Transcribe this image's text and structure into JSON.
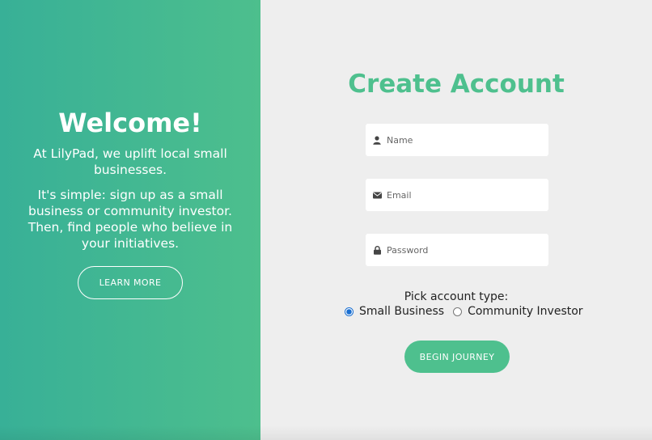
{
  "welcome": {
    "title": "Welcome!",
    "paragraph1": "At LilyPad, we uplift local small businesses.",
    "paragraph2": "It's simple: sign up as a small business or community investor. Then, find people who believe in your initiatives.",
    "learn_more_label": "LEARN MORE"
  },
  "form": {
    "title": "Create Account",
    "name_placeholder": "Name",
    "email_placeholder": "Email",
    "password_placeholder": "Password",
    "account_type_label": "Pick account type:",
    "account_types": [
      {
        "label": "Small Business",
        "selected": true
      },
      {
        "label": "Community Investor",
        "selected": false
      }
    ],
    "submit_label": "BEGIN JOURNEY"
  },
  "colors": {
    "accent": "#4ec08e",
    "gradient_start": "#38b097",
    "gradient_end": "#4dbf8d",
    "background": "#eeeeee"
  },
  "icons": {
    "name_field": "user-icon",
    "email_field": "envelope-icon",
    "password_field": "lock-icon"
  }
}
